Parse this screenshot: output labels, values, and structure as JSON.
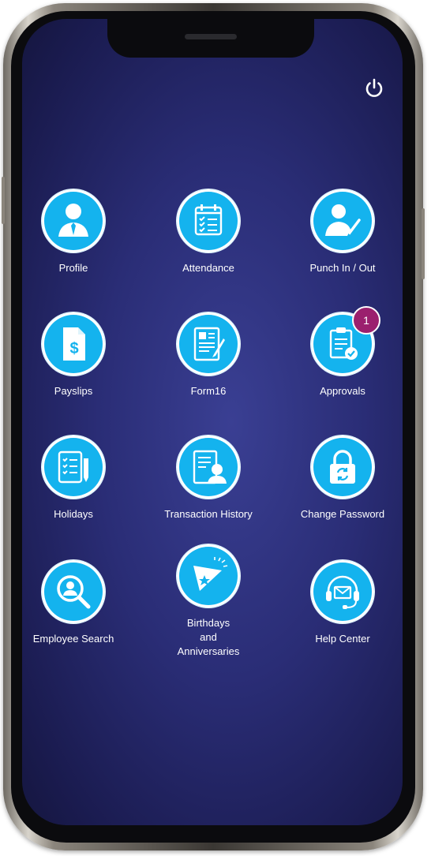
{
  "colors": {
    "tile_circle": "#14b3ee",
    "badge": "#9b1f6e",
    "screen_bg": "#2a2d76"
  },
  "header": {
    "power_icon": "power-icon"
  },
  "tiles": [
    {
      "label": "Profile",
      "icon": "profile-icon"
    },
    {
      "label": "Attendance",
      "icon": "calendar-checklist-icon"
    },
    {
      "label": "Punch In / Out",
      "icon": "user-check-icon"
    },
    {
      "label": "Payslips",
      "icon": "payslip-document-icon"
    },
    {
      "label": "Form16",
      "icon": "form-document-icon"
    },
    {
      "label": "Approvals",
      "icon": "clipboard-check-icon",
      "badge": "1"
    },
    {
      "label": "Holidays",
      "icon": "holiday-list-icon"
    },
    {
      "label": "Transaction History",
      "icon": "transaction-history-icon"
    },
    {
      "label": "Change Password",
      "icon": "lock-refresh-icon"
    },
    {
      "label": "Employee Search",
      "icon": "employee-search-icon"
    },
    {
      "label_lines": [
        "Birthdays",
        "and",
        "Anniversaries"
      ],
      "icon": "party-popper-icon"
    },
    {
      "label": "Help Center",
      "icon": "headset-mail-icon"
    }
  ]
}
